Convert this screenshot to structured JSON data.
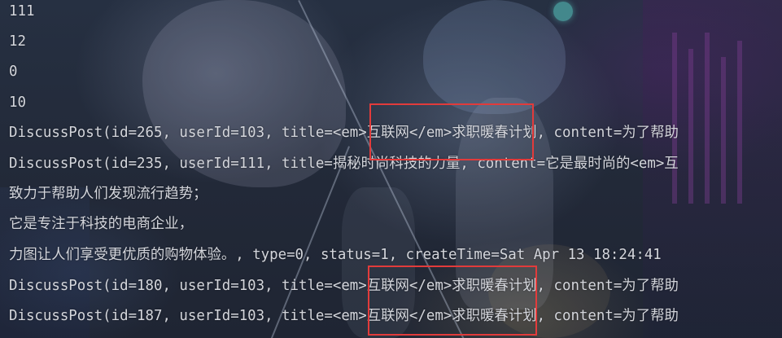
{
  "console": {
    "lines": [
      "111",
      "12",
      "0",
      "10",
      "DiscussPost(id=265, userId=103, title=<em>互联网</em>求职暖春计划, content=为了帮助",
      "DiscussPost(id=235, userId=111, title=揭秘时尚科技的力量, content=它是最时尚的<em>互",
      "致力于帮助人们发现流行趋势；",
      "它是专注于科技的电商企业，",
      "力图让人们享受更优质的购物体验。, type=0, status=1, createTime=Sat Apr 13 18:24:41",
      "DiscussPost(id=180, userId=103, title=<em>互联网</em>求职暖春计划, content=为了帮助",
      "DiscussPost(id=187, userId=103, title=<em>互联网</em>求职暖春计划, content=为了帮助"
    ]
  },
  "colors": {
    "console_text": "#d4d6dc",
    "highlight_border": "#e23b3b",
    "background": "#242b3b"
  }
}
